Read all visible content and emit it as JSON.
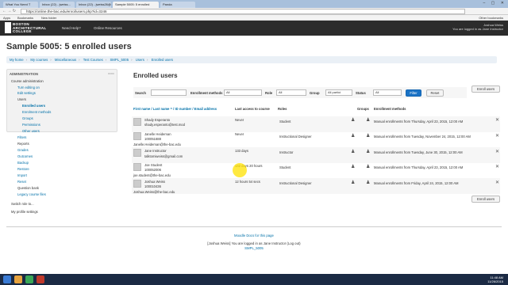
{
  "browser": {
    "tabs": [
      "What You Need T",
      "Inbox (22) - jweiss...",
      "Inbox (22) - jweiss26@g...",
      "Sample 5005: 5 enrolled",
      "Panda"
    ],
    "url": "https://online.the-bac.edu/enrol/users.php?id=3246",
    "bookmarks": [
      "Apps",
      "Bookmarks",
      "New folder",
      "Other bookmarks"
    ]
  },
  "site": {
    "logo_text": [
      "BOSTON",
      "ARCHITECTURAL",
      "COLLEGE"
    ],
    "nav": [
      "Need Help?",
      "Online Resources"
    ],
    "user_name": "Joshua Weiss",
    "user_status": "You are logged in as Jane Instructor"
  },
  "page": {
    "title": "Sample 5005: 5 enrolled users",
    "breadcrumbs": [
      "My home",
      "My courses",
      "Miscellaneous",
      "Test Courses",
      "SMPL_5005",
      "Users",
      "Enrolled users"
    ]
  },
  "sidebar": {
    "heading": "ADMINISTRATION",
    "items": [
      "Course administration",
      "Turn editing on",
      "Edit settings",
      "Users",
      "Enrolled users",
      "Enrolment methods",
      "Groups",
      "Permissions",
      "Other users",
      "Filters",
      "Reports",
      "Grades",
      "Outcomes",
      "Backup",
      "Restore",
      "Import",
      "Reset",
      "Question bank",
      "Legacy course files",
      "Switch role to...",
      "My profile settings"
    ]
  },
  "content": {
    "heading": "Enrolled users",
    "enrol_button": "Enroll users",
    "filter": {
      "search_label": "Search",
      "enrol_label": "Enrollment methods",
      "enrol_value": "All",
      "role_label": "Role",
      "role_value": "All",
      "group_label": "Group",
      "group_value": "All partici",
      "status_label": "Status",
      "status_value": "All",
      "filter_btn": "Filter",
      "reset_btn": "Reset"
    },
    "headers": {
      "name": "First name / Last name ^ / ID number / Email address",
      "access": "Last access to course",
      "roles": "Roles",
      "groups": "Groups",
      "methods": "Enrollment methods"
    },
    "rows": [
      {
        "name": "Shady Esperanto",
        "id": "",
        "email": "shady.esperanto@test.mod",
        "access": "Never",
        "role": "Student",
        "method": "Manual enrollments from Thursday, April 23, 2015, 12:00 AM"
      },
      {
        "name": "Janelle Heideman",
        "id": "100051688",
        "email": "Janelle.Heideman@the-bac.edu",
        "access": "Never",
        "role": "Instructional Designer",
        "method": "Manual enrollments from Tuesday, November 24, 2015, 12:00 AM"
      },
      {
        "name": "Jane Instructor",
        "id": "",
        "email": "talktomiweiss@gmail.com",
        "access": "133 days",
        "role": "Instructor",
        "method": "Manual enrollments from Tuesday, June 30, 2015, 12:00 AM"
      },
      {
        "name": "Joe Student",
        "id": "100052006",
        "email": "joe.student@the-bac.edu",
        "access": "142 days 20 hours",
        "role": "Student",
        "method": "Manual enrollments from Thursday, April 23, 2015, 12:00 AM"
      },
      {
        "name": "Joshua Weiss",
        "id": "100010436",
        "email": "Joshua.Weiss@the-bac.edu",
        "access": "12 hours 54 secs",
        "role": "Instructional Designer",
        "method": "Manual enrollments from Friday, April 24, 2015, 12:00 AM"
      }
    ]
  },
  "footer": {
    "docs": "Moodle Docs for this page",
    "logged": "[Joshua Weiss] You are logged in as Jane Instructor (Log out)",
    "course": "SMPL_5005"
  },
  "taskbar": {
    "time": "11:48 AM",
    "date": "11/26/2015"
  }
}
